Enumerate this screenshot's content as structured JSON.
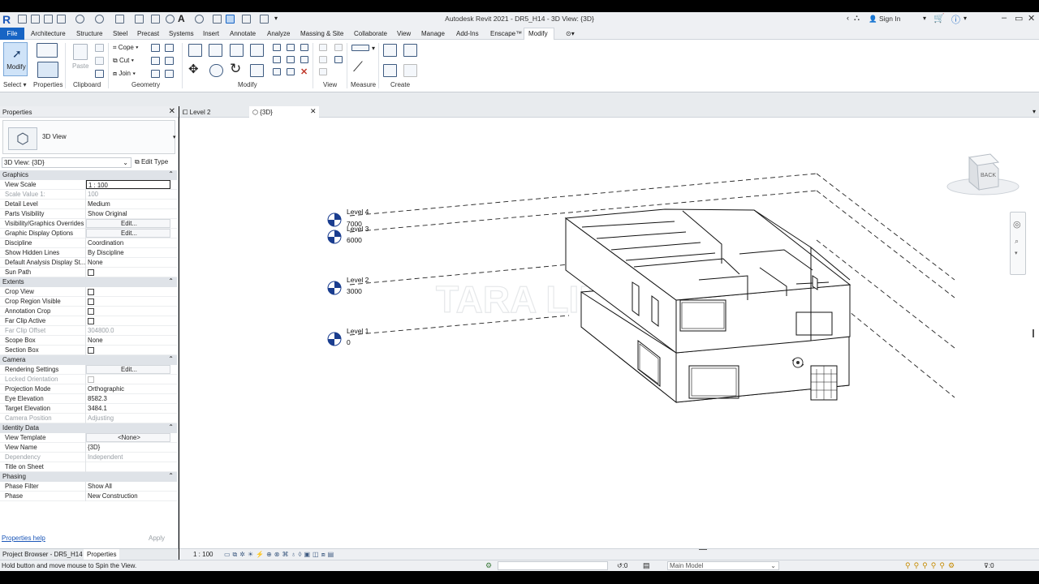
{
  "app": {
    "title": "Autodesk Revit 2021 - DR5_H14 - 3D View: {3D}",
    "logo": "R",
    "sign_in": "Sign In",
    "accent": "#1764c4"
  },
  "menu": {
    "items": [
      "File",
      "Architecture",
      "Structure",
      "Steel",
      "Precast",
      "Systems",
      "Insert",
      "Annotate",
      "Analyze",
      "Massing & Site",
      "Collaborate",
      "View",
      "Manage",
      "Add-Ins",
      "Enscape™",
      "Modify"
    ]
  },
  "ribbon": {
    "modify": "Modify",
    "select": "Select",
    "properties": "Properties",
    "paste": "Paste",
    "cope": "Cope",
    "cut": "Cut",
    "join": "Join",
    "panels": [
      "Clipboard",
      "Geometry",
      "Modify",
      "View",
      "Measure",
      "Create"
    ]
  },
  "properties": {
    "title": "Properties",
    "type_name": "3D View",
    "view_selector": "3D View: {3D}",
    "edit_type": "Edit Type",
    "groups": [
      {
        "name": "Graphics",
        "rows": [
          {
            "k": "View Scale",
            "v": "1 : 100",
            "style": "boxed"
          },
          {
            "k": "Scale Value    1:",
            "v": "100",
            "dim": true
          },
          {
            "k": "Detail Level",
            "v": "Medium"
          },
          {
            "k": "Parts Visibility",
            "v": "Show Original"
          },
          {
            "k": "Visibility/Graphics Overrides",
            "v": "Edit...",
            "style": "btn"
          },
          {
            "k": "Graphic Display Options",
            "v": "Edit...",
            "style": "btn"
          },
          {
            "k": "Discipline",
            "v": "Coordination"
          },
          {
            "k": "Show Hidden Lines",
            "v": "By Discipline"
          },
          {
            "k": "Default Analysis Display St...",
            "v": "None"
          },
          {
            "k": "Sun Path",
            "v": "",
            "cb": true
          }
        ]
      },
      {
        "name": "Extents",
        "rows": [
          {
            "k": "Crop View",
            "v": "",
            "cb": true
          },
          {
            "k": "Crop Region Visible",
            "v": "",
            "cb": true
          },
          {
            "k": "Annotation Crop",
            "v": "",
            "cb": true
          },
          {
            "k": "Far Clip Active",
            "v": "",
            "cb": true
          },
          {
            "k": "Far Clip Offset",
            "v": "304800.0",
            "dim": true
          },
          {
            "k": "Scope Box",
            "v": "None"
          },
          {
            "k": "Section Box",
            "v": "",
            "cb": true
          }
        ]
      },
      {
        "name": "Camera",
        "rows": [
          {
            "k": "Rendering Settings",
            "v": "Edit...",
            "style": "btn"
          },
          {
            "k": "Locked Orientation",
            "v": "",
            "cb": true,
            "dim": true
          },
          {
            "k": "Projection Mode",
            "v": "Orthographic"
          },
          {
            "k": "Eye Elevation",
            "v": "8582.3"
          },
          {
            "k": "Target Elevation",
            "v": "3484.1"
          },
          {
            "k": "Camera Position",
            "v": "Adjusting",
            "dim": true
          }
        ]
      },
      {
        "name": "Identity Data",
        "rows": [
          {
            "k": "View Template",
            "v": "<None>",
            "style": "btn"
          },
          {
            "k": "View Name",
            "v": "{3D}"
          },
          {
            "k": "Dependency",
            "v": "Independent",
            "dim": true
          },
          {
            "k": "Title on Sheet",
            "v": ""
          }
        ]
      },
      {
        "name": "Phasing",
        "rows": [
          {
            "k": "Phase Filter",
            "v": "Show All"
          },
          {
            "k": "Phase",
            "v": "New Construction"
          }
        ]
      }
    ],
    "help": "Properties help",
    "apply": "Apply"
  },
  "bottom_tabs": [
    "Project Browser - DR5_H14",
    "Properties"
  ],
  "view_tabs": [
    "Level 2",
    "{3D}"
  ],
  "canvas": {
    "levels": [
      {
        "name": "Level 4",
        "elev": "7000"
      },
      {
        "name": "Level 3",
        "elev": "6000"
      },
      {
        "name": "Level 2",
        "elev": "3000"
      },
      {
        "name": "Level 1",
        "elev": "0"
      }
    ],
    "viewcube_face": "BACK",
    "watermark": "TARA LIM"
  },
  "status": {
    "scale": "1 : 100",
    "message": "Hold button and move mouse to Spin the View.",
    "count": ":0",
    "model": "Main Model",
    "filter_count": ":0"
  }
}
